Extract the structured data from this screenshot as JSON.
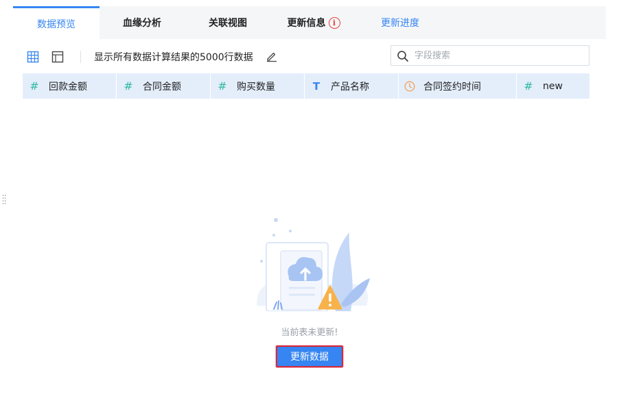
{
  "tabs": [
    {
      "label": "数据预览",
      "active": true
    },
    {
      "label": "血缘分析"
    },
    {
      "label": "关联视图"
    },
    {
      "label": "更新信息",
      "badge": "i"
    },
    {
      "label": "更新进度"
    }
  ],
  "toolbar": {
    "preview_text": "显示所有数据计算结果的5000行数据"
  },
  "search": {
    "placeholder": "字段搜索",
    "value": ""
  },
  "columns": [
    {
      "type": "#",
      "label": "回款金额"
    },
    {
      "type": "#",
      "label": "合同金额"
    },
    {
      "type": "#",
      "label": "购买数量"
    },
    {
      "type": "T",
      "label": "产品名称"
    },
    {
      "type": "clock-icon",
      "label": "合同签约时间"
    },
    {
      "type": "#",
      "label": "new"
    }
  ],
  "empty_state": {
    "message": "当前表未更新!",
    "button_label": "更新数据"
  },
  "colors": {
    "accent": "#3685f2",
    "number_type": "#33b9a4",
    "date_type": "#f5a25c",
    "warning": "#f7b24b",
    "error": "#e8413c"
  }
}
